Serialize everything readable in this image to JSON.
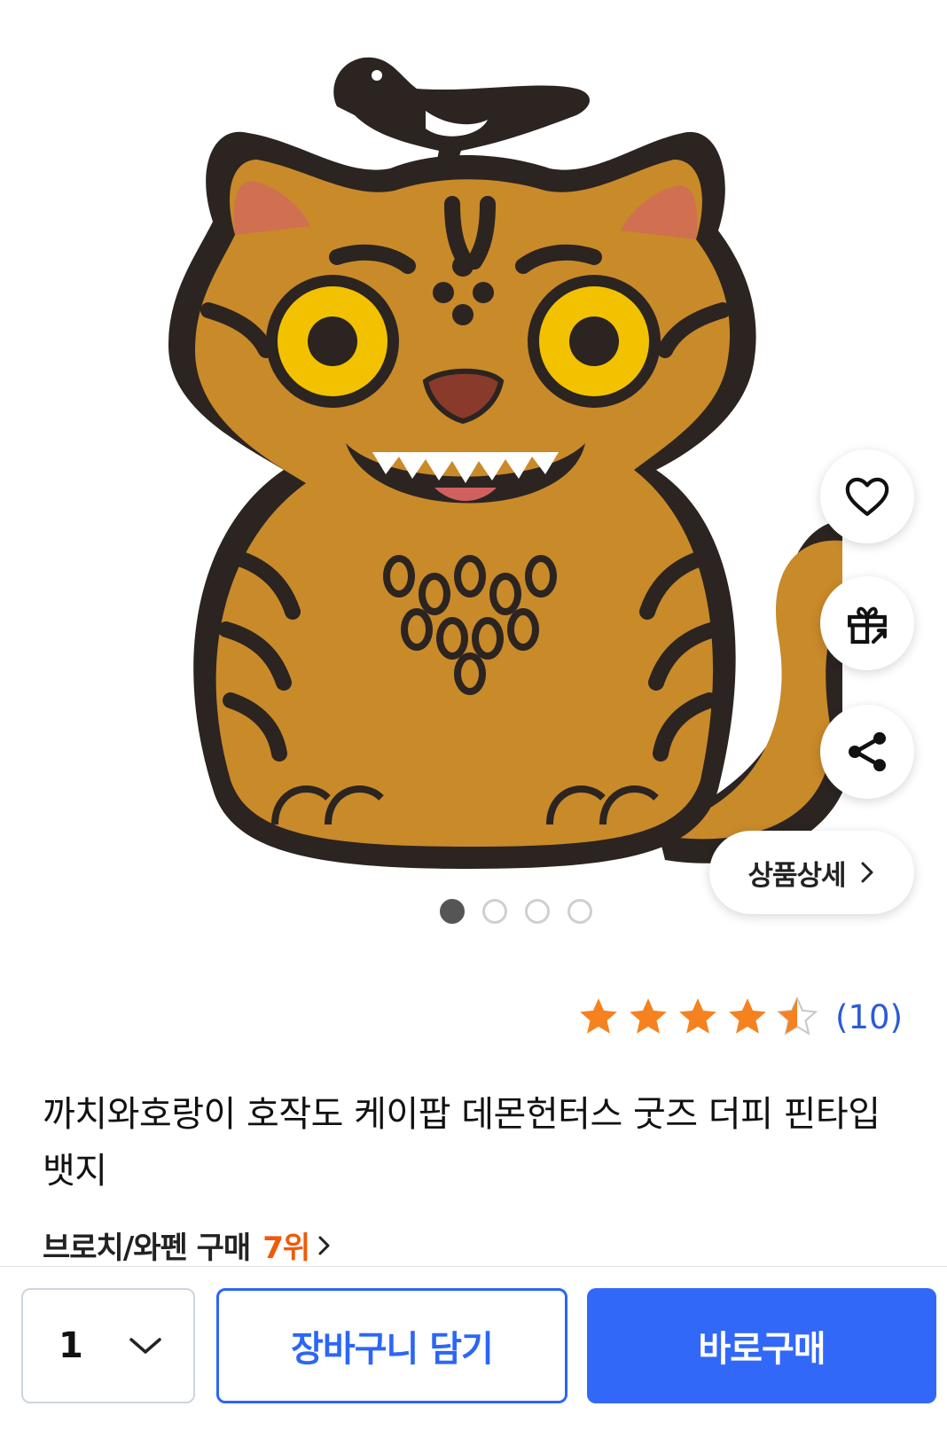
{
  "product_image": {
    "alt_icon": "tiger-pin-badge-image",
    "page_count": 4,
    "current_page": 1
  },
  "actions": {
    "like_icon": "heart-icon",
    "gift_icon": "gift-icon",
    "share_icon": "share-icon",
    "detail_label": "상품상세"
  },
  "rating": {
    "stars": 4.5,
    "review_count": "(10)"
  },
  "product": {
    "title": "까치와호랑이 호작도 케이팝 데몬헌터스 굿즈 더피 핀타입 뱃지"
  },
  "rank": {
    "category_text": "브로치/와펜 구매",
    "rank_value": "7위"
  },
  "bottom_bar": {
    "quantity": "1",
    "cart_label": "장바구니 담기",
    "buy_label": "바로구매"
  },
  "colors": {
    "accent_blue": "#3268f8",
    "rank_orange": "#f05a0a",
    "star_orange": "#f5821f",
    "review_blue": "#2c5bd6"
  }
}
